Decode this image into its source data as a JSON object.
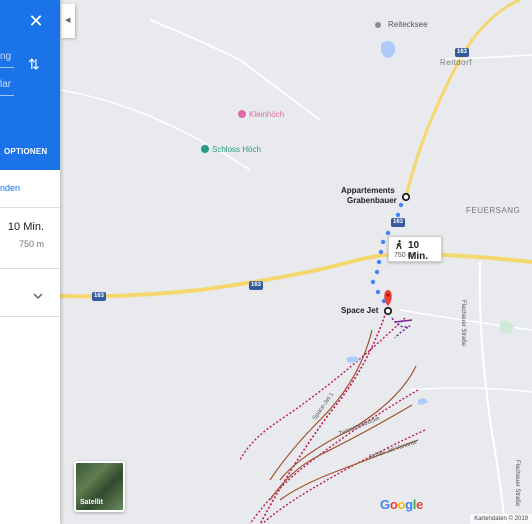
{
  "panel": {
    "options_label": "OPTIONEN",
    "send_link": "nden",
    "from_placeholder": "ng",
    "to_placeholder": "lar",
    "route": {
      "time": "10 Min.",
      "distance": "750 m"
    }
  },
  "map": {
    "places": {
      "reitecksee": "Reitecksee",
      "reitdorf": "Reitdorf",
      "kleinhoch": "Kleinhöch",
      "schloss": "Schloss Höch",
      "feuersang": "FEUERSANG",
      "appartements_line1": "Appartements",
      "appartements_line2": "Grabenbauer",
      "space_jet": "Space Jet"
    },
    "road_numbers": {
      "r1": "163",
      "r2": "163",
      "r3": "163",
      "r4": "163"
    },
    "road_labels": {
      "flachauer1": "Flachauer Straße",
      "flachauer2": "Flachauer Straße",
      "space_jet_piste": "Space-Jet 1",
      "zeitmess": "Zeitmessstrecke",
      "achter": "Achter Jet Variante"
    },
    "walk_callout": {
      "time": "10 Min.",
      "distance": "750 m"
    },
    "satellite_label": "Satellit",
    "attribution": "Kartendaten © 2019",
    "colors": {
      "route": "#4285f4",
      "highway": "#f5d76e",
      "pin": "#ea4335",
      "piste": "#c2185b"
    }
  }
}
